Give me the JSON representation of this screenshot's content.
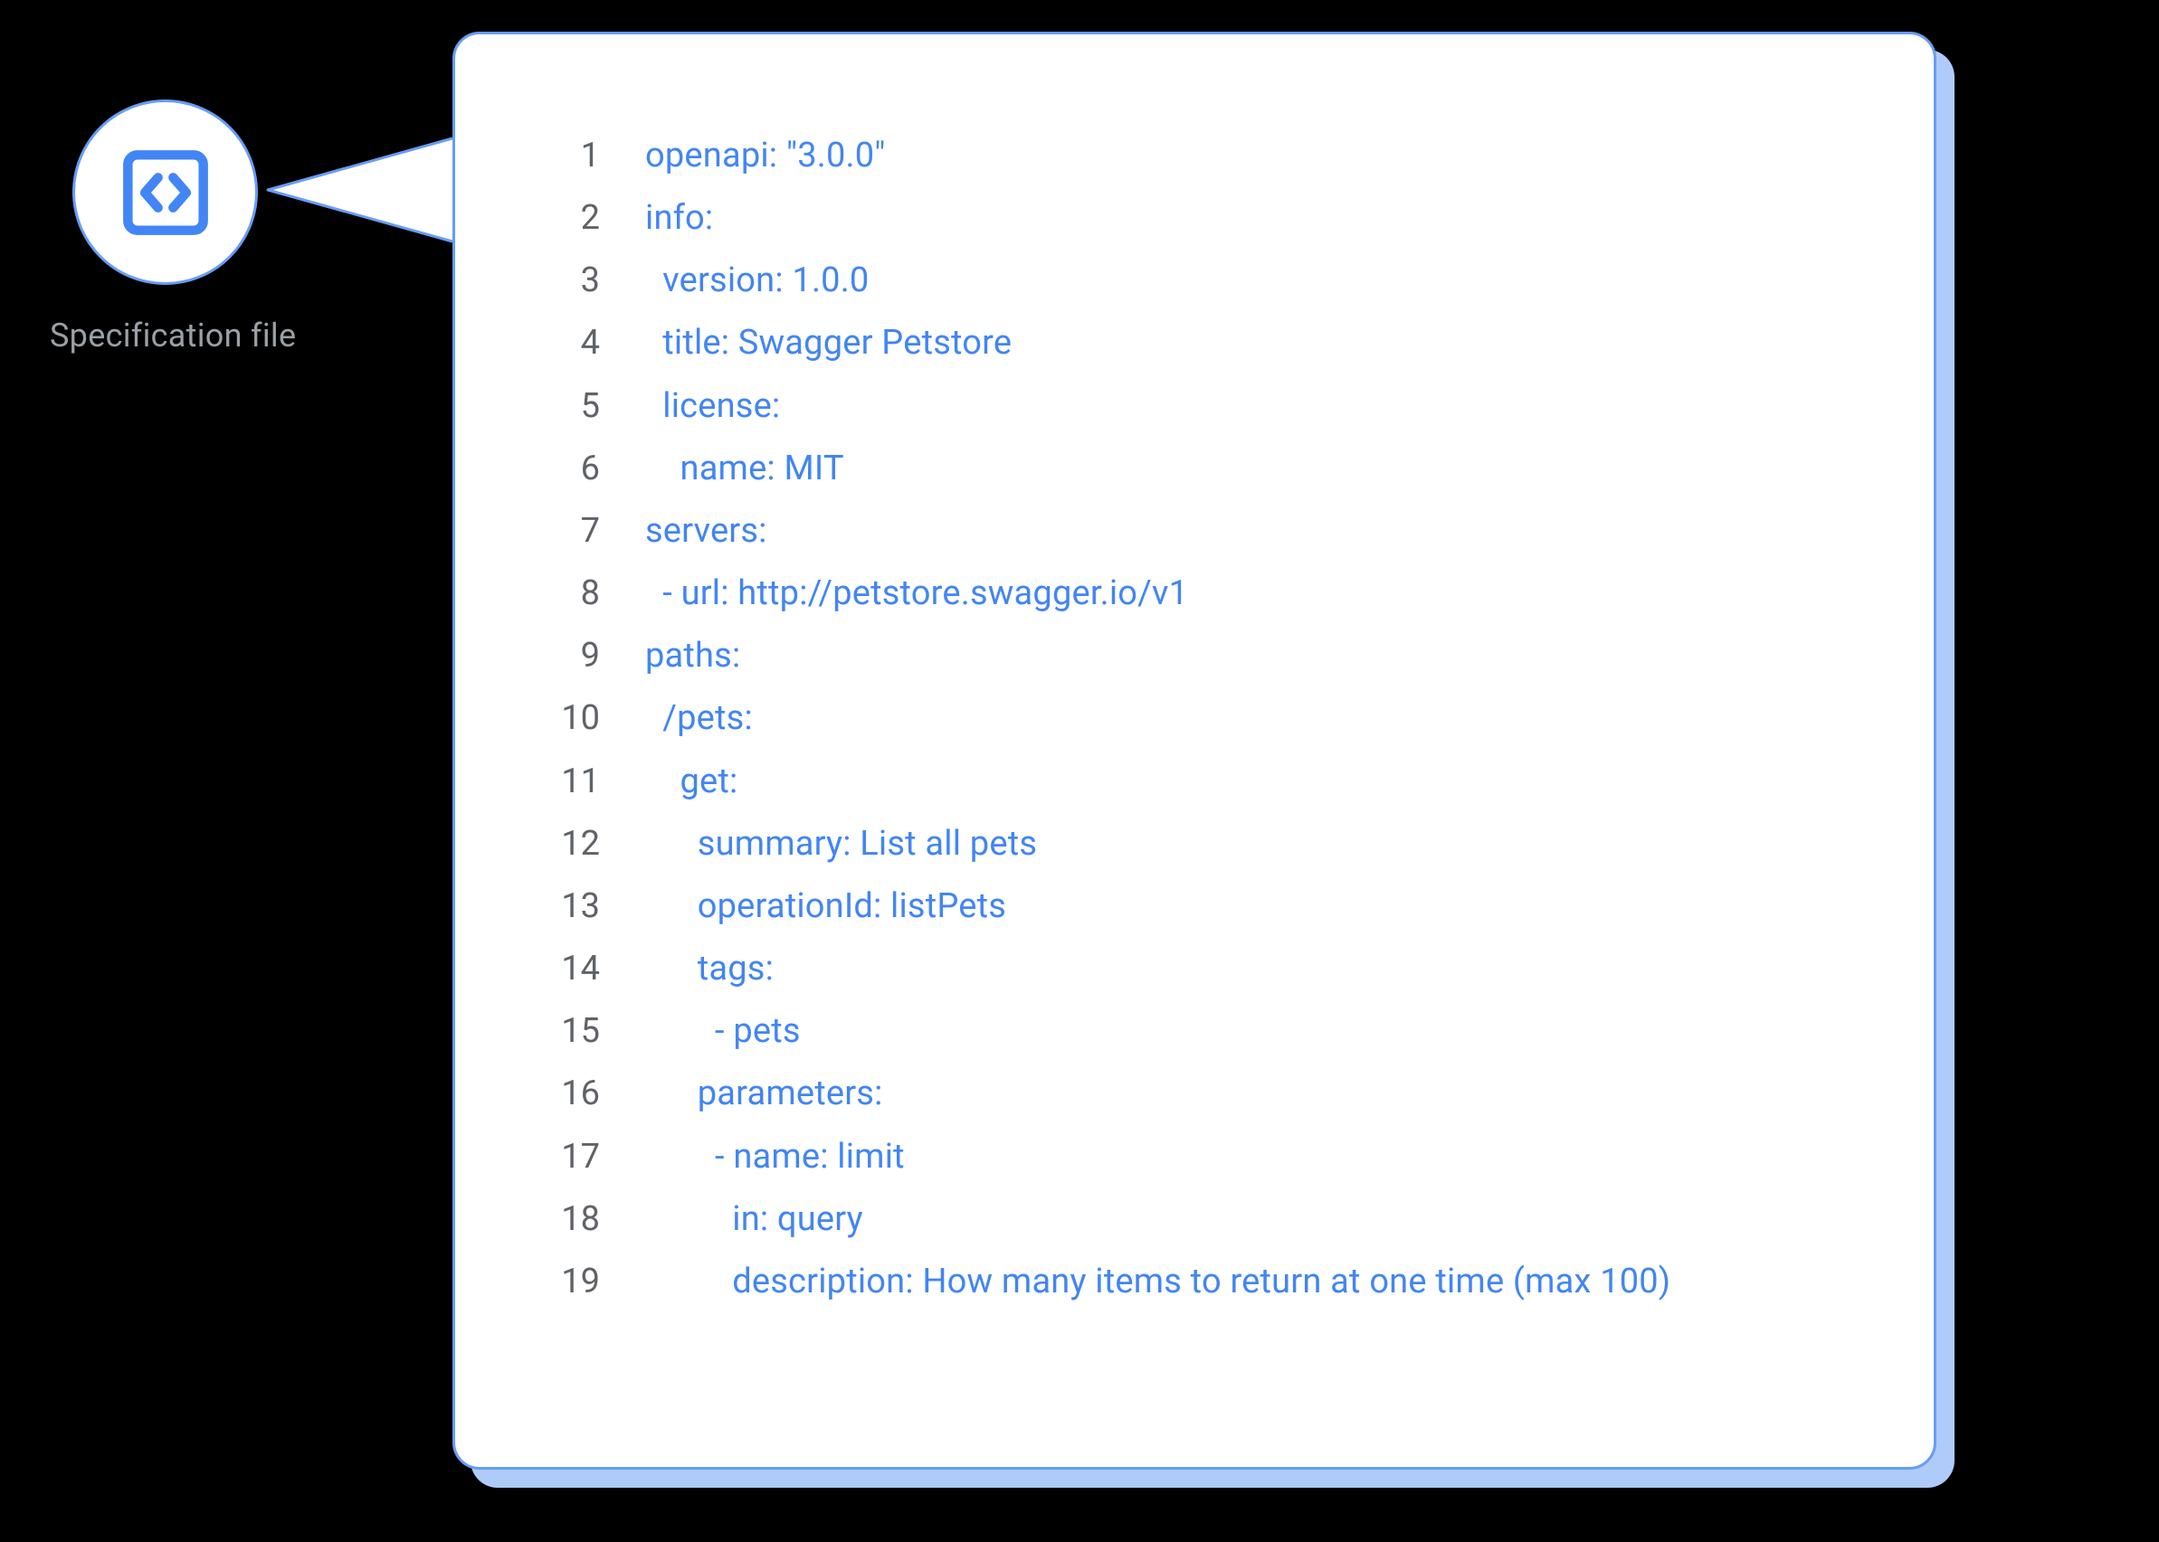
{
  "label": "Specification file",
  "icon_name": "code-file-icon",
  "code_lines": [
    {
      "num": "1",
      "text": "openapi: \"3.0.0\""
    },
    {
      "num": "2",
      "text": "info:"
    },
    {
      "num": "3",
      "text": "  version: 1.0.0"
    },
    {
      "num": "4",
      "text": "  title: Swagger Petstore"
    },
    {
      "num": "5",
      "text": "  license:"
    },
    {
      "num": "6",
      "text": "    name: MIT"
    },
    {
      "num": "7",
      "text": "servers:"
    },
    {
      "num": "8",
      "text": "  - url: http://petstore.swagger.io/v1"
    },
    {
      "num": "9",
      "text": "paths:"
    },
    {
      "num": "10",
      "text": "  /pets:"
    },
    {
      "num": "11",
      "text": "    get:"
    },
    {
      "num": "12",
      "text": "      summary: List all pets"
    },
    {
      "num": "13",
      "text": "      operationId: listPets"
    },
    {
      "num": "14",
      "text": "      tags:"
    },
    {
      "num": "15",
      "text": "        - pets"
    },
    {
      "num": "16",
      "text": "      parameters:"
    },
    {
      "num": "17",
      "text": "        - name: limit"
    },
    {
      "num": "18",
      "text": "          in: query"
    },
    {
      "num": "19",
      "text": "          description: How many items to return at one time (max 100)"
    }
  ]
}
